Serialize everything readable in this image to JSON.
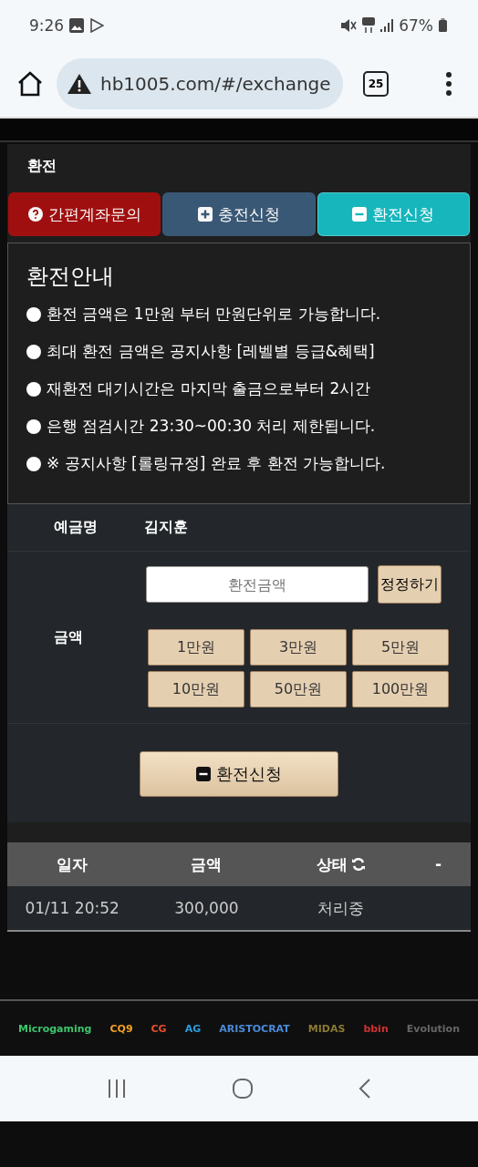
{
  "status_bar": {
    "time": "9:26",
    "battery": "67%"
  },
  "browser": {
    "url": "hb1005.com/#/exchange",
    "tab_count": "25"
  },
  "page": {
    "title": "환전",
    "tabs": [
      {
        "label": "간편계좌문의",
        "kind": "question",
        "selected": false
      },
      {
        "label": "충전신청",
        "kind": "plus",
        "selected": false
      },
      {
        "label": "환전신청",
        "kind": "minus",
        "selected": true
      }
    ],
    "notice": {
      "title": "환전안내",
      "items": [
        "환전 금액은 1만원 부터 만원단위로 가능합니다.",
        "최대 환전 금액은 공지사항 [레벨별 등급&혜택]",
        "재환전 대기시간은 마지막 출금으로부터 2시간",
        "은행 점검시간 23:30~00:30 처리 제한됩니다.",
        "※ 공지사항 [롤링규정] 완료 후 환전 가능합니다."
      ]
    },
    "form": {
      "name_label": "예금명",
      "name_value": "김지훈",
      "amount_label": "금액",
      "amount_placeholder": "환전금액",
      "correct_button": "정정하기",
      "amount_buttons": [
        "1만원",
        "3만원",
        "5만원",
        "10만원",
        "50만원",
        "100만원"
      ],
      "submit_button": "환전신청"
    },
    "history": {
      "columns": [
        "일자",
        "금액",
        "상태",
        "-"
      ],
      "rows": [
        {
          "date": "01/11 20:52",
          "amount": "300,000",
          "status": "처리중"
        }
      ]
    }
  },
  "logos": [
    {
      "text": "Microgaming",
      "color": "#3ec46d"
    },
    {
      "text": "CQ9",
      "color": "#f0a020"
    },
    {
      "text": "CG",
      "color": "#e8502a"
    },
    {
      "text": "AG",
      "color": "#2a9de0"
    },
    {
      "text": "ARISTOCRAT",
      "color": "#4a8ad8"
    },
    {
      "text": "MIDAS",
      "color": "#8a7a30"
    },
    {
      "text": "bbin",
      "color": "#d03030"
    },
    {
      "text": "Evolution",
      "color": "#666666"
    }
  ]
}
